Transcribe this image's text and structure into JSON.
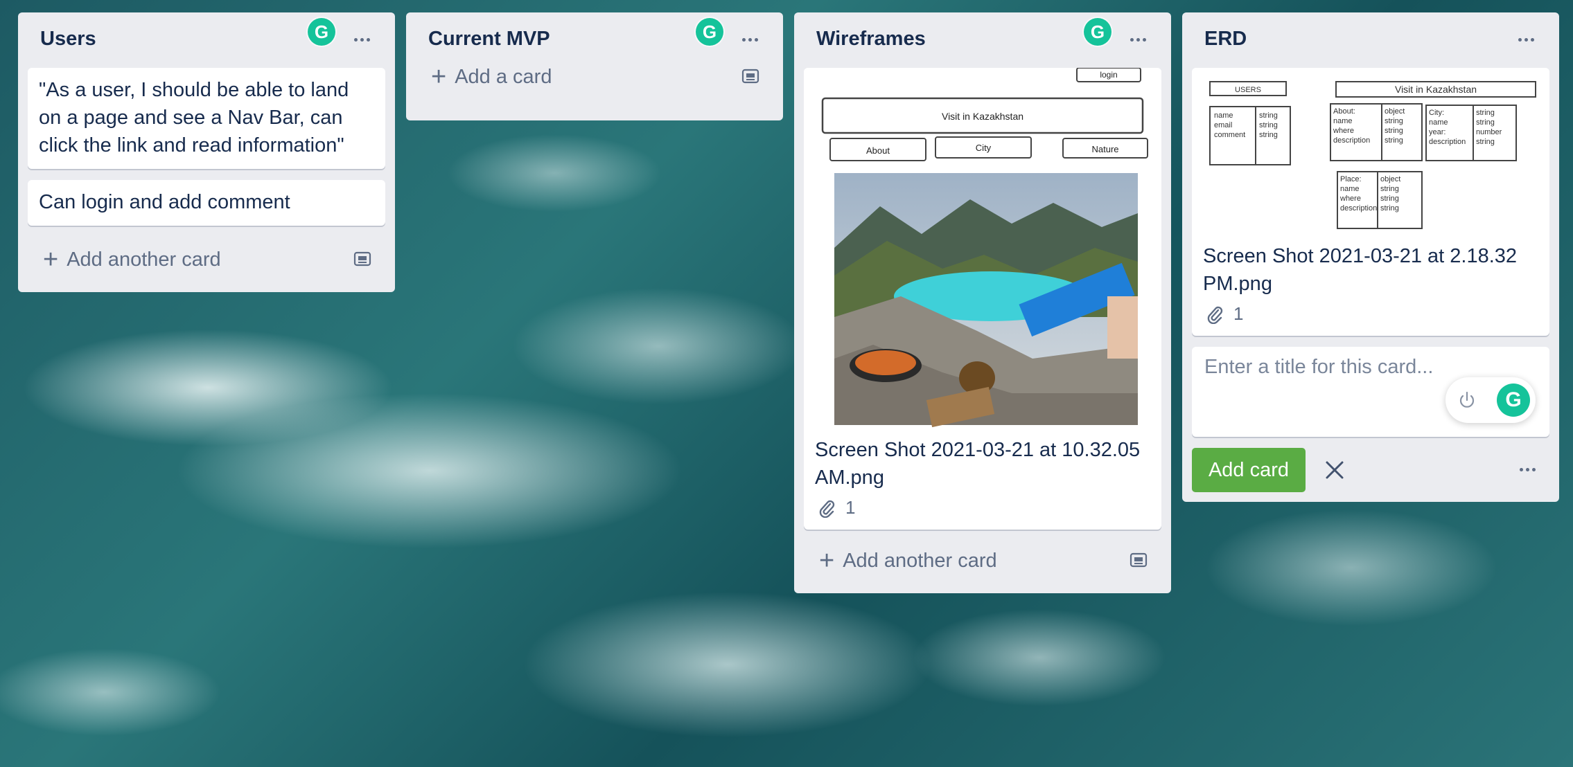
{
  "lists": {
    "users": {
      "title": "Users",
      "cards": [
        "\"As a user, I should be able to land on a page and see a Nav Bar, can click the link and read information\"",
        "Can login and add comment"
      ],
      "add_label": "Add another card"
    },
    "mvp": {
      "title": "Current MVP",
      "add_label": "Add a card"
    },
    "wireframes": {
      "title": "Wireframes",
      "wire": {
        "login": "login",
        "banner": "Visit in Kazakhstan",
        "nav": [
          "About",
          "City",
          "Nature"
        ]
      },
      "card_title": "Screen Shot 2021-03-21 at 10.32.05 AM.png",
      "attachments": "1",
      "add_label": "Add another card"
    },
    "erd": {
      "title": "ERD",
      "diagram": {
        "users": {
          "name": "USERS",
          "fields": "name\nemail\ncomment",
          "types": "string\nstring\nstring"
        },
        "visit": {
          "name": "Visit in Kazakhstan"
        },
        "about": {
          "fields": "About:\nname\nwhere\ndescription",
          "types": "object\nstring\nstring\nstring"
        },
        "city": {
          "fields": "City:\nname\nyear:\ndescription",
          "types": "string\nstring\nnumber\nstring"
        },
        "place": {
          "fields": "Place:\nname\nwhere\ndescription",
          "types": "object\nstring\nstring\nstring"
        }
      },
      "card_title": "Screen Shot 2021-03-21 at 2.18.32 PM.png",
      "attachments": "1",
      "composer_placeholder": "Enter a title for this card...",
      "add_button": "Add card"
    }
  },
  "colors": {
    "list_bg": "#ebecf0",
    "add_green": "#5aac44",
    "grammarly": "#15c39a"
  },
  "icons": [
    "grammarly-icon",
    "more-dots-icon",
    "plus-icon",
    "template-card-icon",
    "paperclip-icon",
    "power-icon",
    "close-icon"
  ]
}
